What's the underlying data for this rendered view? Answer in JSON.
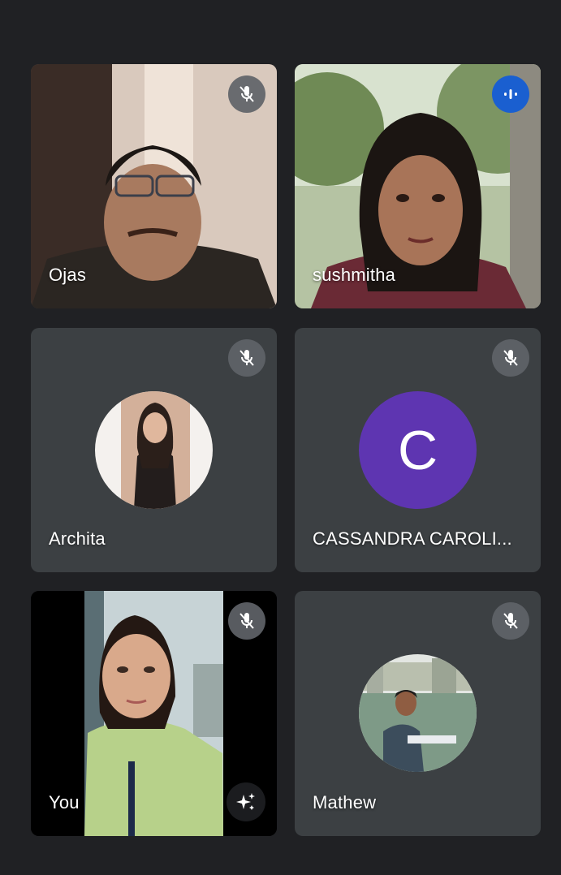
{
  "participants": [
    {
      "name": "Ojas",
      "kind": "video",
      "muted": true
    },
    {
      "name": "sushmitha",
      "kind": "video",
      "muted": false,
      "speaking": true
    },
    {
      "name": "Archita",
      "kind": "photo-avatar",
      "muted": true
    },
    {
      "name": "CASSANDRA CAROLI...",
      "kind": "letter-avatar",
      "avatar_letter": "C",
      "avatar_color": "#5e35b1",
      "muted": true
    },
    {
      "name": "You",
      "kind": "self-video",
      "muted": true
    },
    {
      "name": "Mathew",
      "kind": "photo-avatar",
      "muted": true
    }
  ],
  "icons": {
    "muted": "mic-off-icon",
    "speaking": "audio-level-icon",
    "effects": "sparkle-effects-icon"
  },
  "colors": {
    "background": "#202124",
    "tile": "#3c4043",
    "mute_badge": "#5f6368",
    "speaking_badge": "#1a5fd0",
    "letter_avatar": "#5e35b1"
  }
}
